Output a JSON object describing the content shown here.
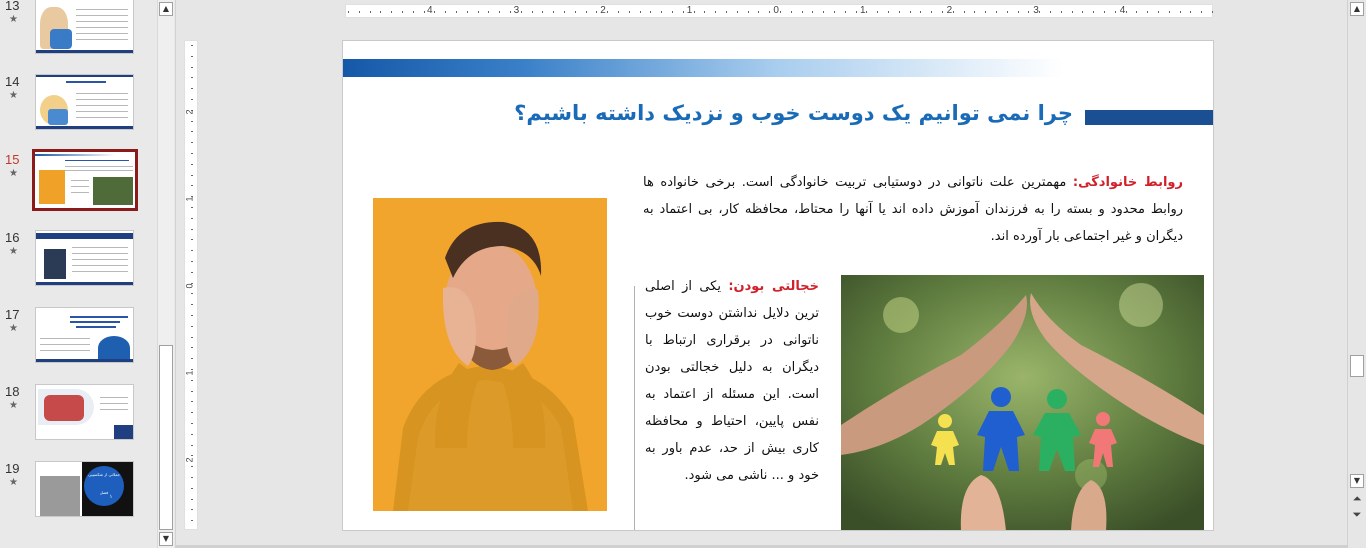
{
  "thumbnails": [
    {
      "number": "13",
      "active": false
    },
    {
      "number": "14",
      "active": false
    },
    {
      "number": "15",
      "active": true
    },
    {
      "number": "16",
      "active": false
    },
    {
      "number": "17",
      "active": false
    },
    {
      "number": "18",
      "active": false
    },
    {
      "number": "19",
      "active": false
    }
  ],
  "thumb_star": "★",
  "thumb_texts": {
    "t19_circle": "جملاتی از شکسپیر، فصل",
    "t19_num": "۱"
  },
  "ruler": {
    "h_labels": [
      "4",
      "3",
      "2",
      "1",
      "0",
      "1",
      "2",
      "3",
      "4"
    ],
    "v_labels": [
      "2",
      "1",
      "0",
      "1",
      "2"
    ]
  },
  "slide": {
    "title": "چرا نمی توانیم یک دوست خوب و نزدیک داشته باشیم؟",
    "para1_label": "روابط خانوادگی:",
    "para1_text": " مهمترین علت ناتوانی در دوستیابی تربیت خانوادگی است. برخی خانواده ها روابط محدود و بسته را به فرزندان آموزش داده اند یا آنها را محتاط، محافظه کار، بی اعتماد به دیگران و غیر اجتماعی بار آورده اند.",
    "para2_label": "خجالتی بودن:",
    "para2_text": " یکی از اصلی ترین دلایل نداشتن دوست خوب ناتوانی در برقراری ارتباط با دیگران به دلیل خجالتی بودن است. این مسئله از اعتماد به نفس پایین، احتیاط و محافظه کاری بیش از حد، عدم باور به خود و ... ناشی می شود."
  },
  "colors": {
    "accent_blue": "#1a6bb7",
    "label_red": "#d0202a",
    "active_thumb": "#8b1a1a"
  },
  "icons": {
    "scroll_up": "▲",
    "scroll_down": "▼",
    "prev_slide": "⏶",
    "next_slide": "⏷"
  }
}
